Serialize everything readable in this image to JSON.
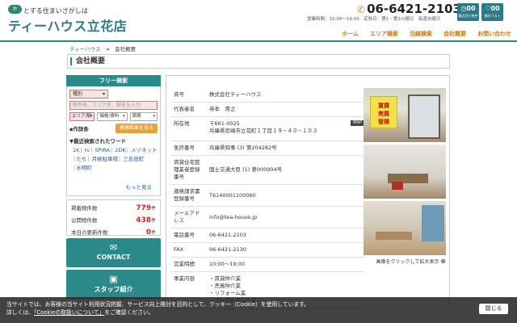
{
  "header": {
    "logo_badge": "ホ",
    "tagline": "とする住まいさがしは",
    "logo": "ティーハウス立花店",
    "phone": "06-6421-2103",
    "hours": "営業時間：10:00〜19:00　定休日：第1・第3火曜日　毎週水曜日",
    "recent_count": "00",
    "recent_label": "最近見た物件",
    "fav_count": "00",
    "fav_label": "検討リスト"
  },
  "nav": [
    "ホーム",
    "エリア検索",
    "沿線検索",
    "会社概要",
    "お問い合わせ"
  ],
  "breadcrumb": {
    "home": "ティーハウス",
    "sep": ">",
    "current": "会社概要"
  },
  "page_title": "会社概要",
  "sidebar": {
    "header": "フリー検索",
    "type_select": "種別",
    "keyword_placeholder": "物件名、エリア名、駅名を入力",
    "area_select": "エリア/駅",
    "price_select": "価格/賃料",
    "layout_select": "面積",
    "conditions_label": "▪作詳条",
    "see_button": "検索結果を見る",
    "recent_title": "▼最近検索されたワード",
    "recent_words": [
      "1K",
      "tv",
      "SPIRA",
      "2DK",
      "メゾネット",
      "たち",
      "月極駐車場",
      "三反田町",
      "水明町"
    ],
    "more": "もっと見る",
    "stats": [
      {
        "label": "掲載物件数",
        "value": "779",
        "unit": "件"
      },
      {
        "label": "公開物件数",
        "value": "438",
        "unit": "件"
      },
      {
        "label": "本日の更新件数",
        "value": "0",
        "unit": "件"
      }
    ],
    "contact_label": "CONTACT",
    "staff_label": "スタッフ紹介"
  },
  "company": {
    "rows": [
      {
        "key": "商号",
        "value": "株式会社ティーハウス"
      },
      {
        "key": "代表者名",
        "value": "寺本　貴之"
      },
      {
        "key": "所在地",
        "value": "〒661-0025\n兵庫県尼崎市立花町１丁目１９−４０−１０３"
      },
      {
        "key": "免許番号",
        "value": "兵庫県知事 (3) 第204282号"
      },
      {
        "key": "賃貸住宅管理業者登録番号",
        "value": "国土交通大臣 (1) 第000904号"
      },
      {
        "key": "適格請求書登録番号",
        "value": "T6140001100060"
      },
      {
        "key": "メールアドレス",
        "value": "info@tea-house.jp"
      },
      {
        "key": "電話番号",
        "value": "06-6421-2103"
      },
      {
        "key": "FAX",
        "value": "06-6421-2130"
      },
      {
        "key": "営業時間",
        "value": "10:00〜19:00"
      },
      {
        "key": "事業内容",
        "value": "・賃貸仲介業\n・売買仲介業\n・リフォーム業\n・コンサルタント業"
      }
    ],
    "map_badge": "MAP",
    "sign_text": "賃貸\n売買\n管理",
    "photo_caption": "画像をクリックして拡大表示"
  },
  "cookie": {
    "line1": "当サイトでは、お客様の当サイト利用状況把握、サービス向上検討を目的として、クッキー（Cookie）を使用しています。",
    "line2_pre": "詳しくは、",
    "line2_link": "「Cookieの取扱いについて」",
    "line2_post": "をご確認ください。",
    "close": "閉じる"
  }
}
